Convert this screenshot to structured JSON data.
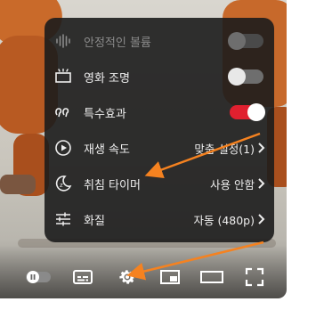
{
  "menu": {
    "items": [
      {
        "label": "안정적인 볼륨",
        "type": "toggle",
        "state": "disabled",
        "icon": "stable-volume-icon"
      },
      {
        "label": "영화 조명",
        "type": "toggle",
        "state": "off",
        "icon": "ambient-mode-icon"
      },
      {
        "label": "특수효과",
        "type": "toggle",
        "state": "on",
        "icon": "annotations-icon"
      },
      {
        "label": "재생 속도",
        "type": "submenu",
        "value": "맞춤 설정(1)",
        "icon": "playback-speed-icon"
      },
      {
        "label": "취침 타이머",
        "type": "submenu",
        "value": "사용 안함",
        "icon": "sleep-timer-icon"
      },
      {
        "label": "화질",
        "type": "submenu",
        "value": "자동 (480p)",
        "icon": "quality-sliders-icon"
      }
    ]
  },
  "controls": {
    "icons": [
      "autoplay-toggle-icon",
      "subtitles-icon",
      "settings-gear-icon",
      "miniplayer-icon",
      "theater-mode-icon",
      "fullscreen-icon"
    ]
  },
  "colors": {
    "accent_red": "#e0202f",
    "annotation_arrow": "#f58220",
    "menu_bg": "#1c1c1c"
  }
}
